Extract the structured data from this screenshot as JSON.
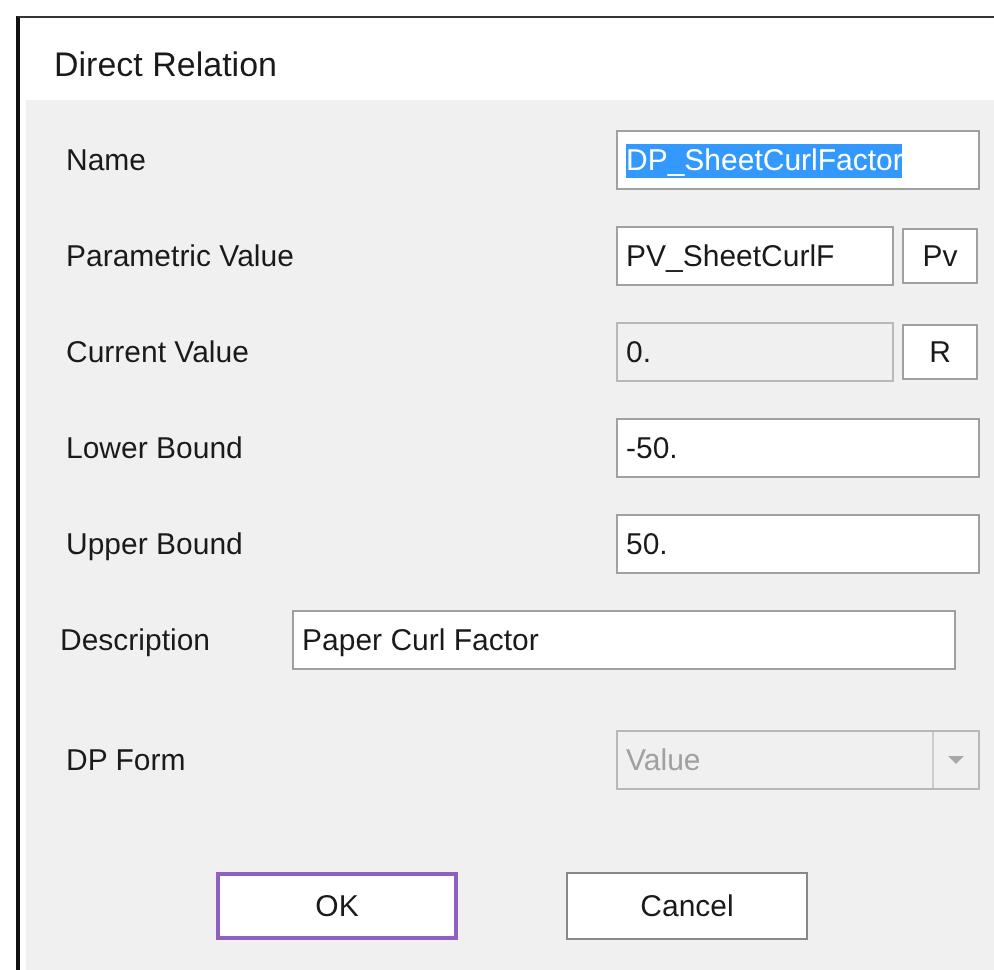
{
  "window": {
    "title": "Direct Relation"
  },
  "rows": [
    {
      "label": "Name",
      "kind": "text",
      "value": "DP_SheetCurlFactor",
      "highlighted": true,
      "disabled": false
    },
    {
      "label": "Parametric Value",
      "kind": "text_button",
      "value": "PV_SheetCurlF",
      "button": "Pv",
      "highlighted": false,
      "disabled": false
    },
    {
      "label": "Current Value",
      "kind": "text_button",
      "value": "0.",
      "button": "R",
      "highlighted": false,
      "disabled": true
    },
    {
      "label": "Lower Bound",
      "kind": "text",
      "value": "-50.",
      "highlighted": false,
      "disabled": false
    },
    {
      "label": "Upper Bound",
      "kind": "text",
      "value": "50.",
      "highlighted": false,
      "disabled": false
    },
    {
      "label": "Description",
      "kind": "wide_text",
      "value": "Paper Curl Factor",
      "highlighted": false,
      "disabled": false
    },
    {
      "label": "DP Form",
      "kind": "select",
      "value": "Value",
      "highlighted": false,
      "disabled": true
    }
  ],
  "buttons": [
    {
      "label": "OK",
      "focused": true
    },
    {
      "label": "Cancel",
      "focused": false
    }
  ]
}
